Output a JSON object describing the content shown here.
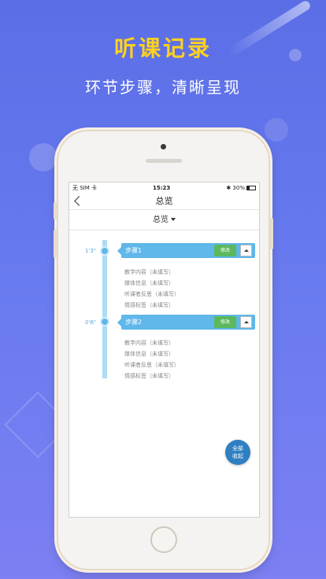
{
  "promo": {
    "headline": "听课记录",
    "subline": "环节步骤，清晰呈现"
  },
  "colors": {
    "accent": "#5fb7ea",
    "headline": "#ffd21f",
    "edit": "#5cb85c",
    "fab": "#2f7fc1"
  },
  "statusbar": {
    "carrier": "无 SIM 卡",
    "time": "15:23",
    "battery": "30%"
  },
  "navbar": {
    "title": "总览"
  },
  "dropdown": {
    "selected": "总览"
  },
  "steps": [
    {
      "time": "1'3\"",
      "title": "步骤1",
      "edit_label": "修改",
      "details": [
        "教学内容（未填写）",
        "媒体信息（未填写）",
        "听课者反思（未填写）",
        "情感标签（未填写）"
      ]
    },
    {
      "time": "0'6\"",
      "title": "步骤2",
      "edit_label": "修改",
      "details": [
        "教学内容（未填写）",
        "媒体信息（未填写）",
        "听课者反思（未填写）",
        "情感标签（未填写）"
      ]
    }
  ],
  "fab": {
    "line1": "全部",
    "line2": "收起"
  }
}
